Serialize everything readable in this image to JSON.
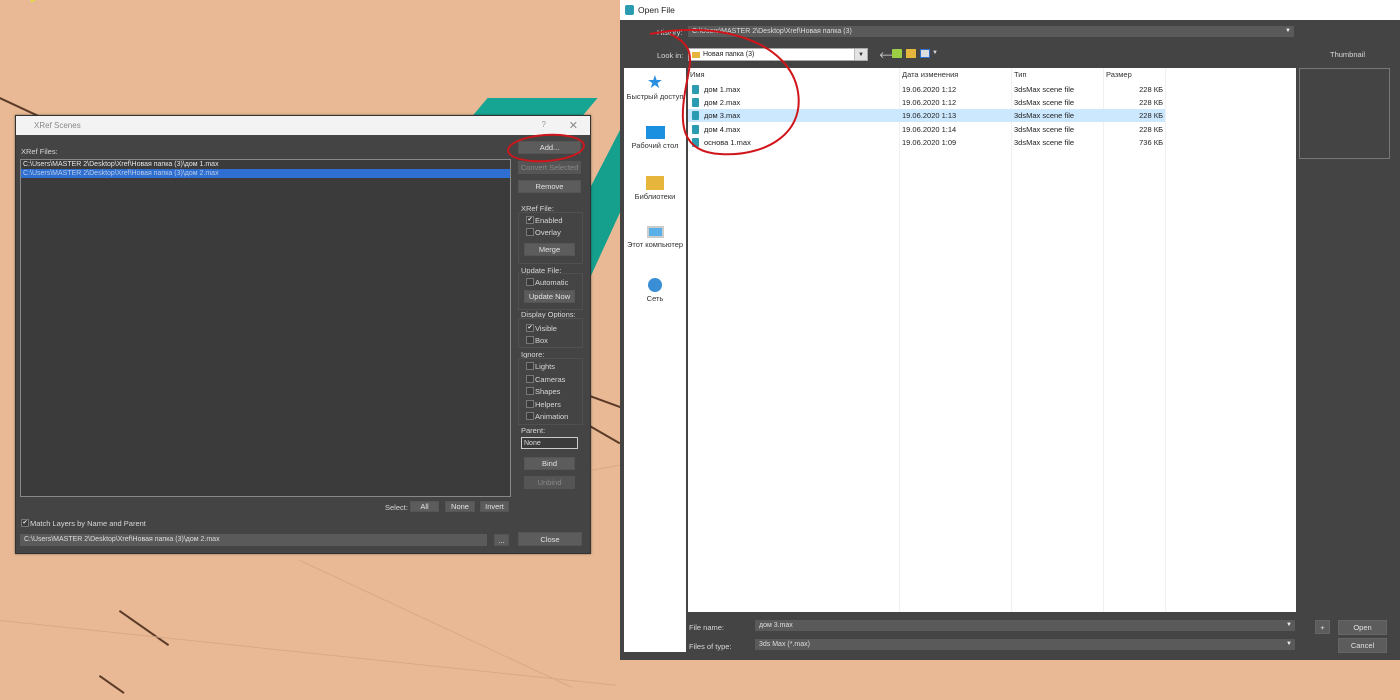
{
  "xref_dialog": {
    "title": "XRef Scenes",
    "help_glyph": "?",
    "close_glyph": "✕",
    "files_label": "XRef Files:",
    "files": [
      {
        "path": "C:\\Users\\MASTER 2\\Desktop\\Xref\\Новая папка (3)\\дом 1.max",
        "selected": false
      },
      {
        "path": "C:\\Users\\MASTER 2\\Desktop\\Xref\\Новая папка (3)\\дом 2.max",
        "selected": true
      }
    ],
    "add_label": "Add...",
    "convert_label": "Convert Selected",
    "remove_label": "Remove",
    "xref_file_label": "XRef File:",
    "enabled_label": "Enabled",
    "overlay_label": "Overlay",
    "merge_label": "Merge",
    "update_file_label": "Update File:",
    "automatic_label": "Automatic",
    "update_now_label": "Update Now",
    "display_options_label": "Display Options:",
    "visible_label": "Visible",
    "box_label": "Box",
    "ignore_label": "Ignore:",
    "lights_label": "Lights",
    "cameras_label": "Cameras",
    "shapes_label": "Shapes",
    "helpers_label": "Helpers",
    "animation_label": "Animation",
    "parent_label": "Parent:",
    "parent_value": "None",
    "bind_label": "Bind",
    "unbind_label": "Unbind",
    "select_label": "Select:",
    "all_label": "All",
    "none_label": "None",
    "invert_label": "Invert",
    "match_layers_label": "Match Layers by Name and Parent",
    "current_path": "C:\\Users\\MASTER 2\\Desktop\\Xref\\Новая папка (3)\\дом 2.max",
    "browse_label": "...",
    "close_label": "Close",
    "check_glyph": "✔"
  },
  "open_dialog": {
    "title": "Open File",
    "history_label": "History:",
    "history_value": "C:\\Users\\MASTER 2\\Desktop\\Xref\\Новая папка (3)",
    "look_in_label": "Look in:",
    "look_in_value": "Новая папка (3)",
    "thumbnail_label": "Thumbnail",
    "places": [
      {
        "label": "Быстрый доступ",
        "icon": "star-icon"
      },
      {
        "label": "Рабочий стол",
        "icon": "desktop-icon"
      },
      {
        "label": "Библиотеки",
        "icon": "libraries-icon"
      },
      {
        "label": "Этот компьютер",
        "icon": "computer-icon"
      },
      {
        "label": "Сеть",
        "icon": "network-icon"
      }
    ],
    "columns": {
      "name": "Имя",
      "date": "Дата изменения",
      "type": "Тип",
      "size": "Размер"
    },
    "files": [
      {
        "name": "дом 1.max",
        "date": "19.06.2020 1:12",
        "type": "3dsMax scene file",
        "size": "228 КБ",
        "selected": false
      },
      {
        "name": "дом 2.max",
        "date": "19.06.2020 1:12",
        "type": "3dsMax scene file",
        "size": "228 КБ",
        "selected": false
      },
      {
        "name": "дом 3.max",
        "date": "19.06.2020 1:13",
        "type": "3dsMax scene file",
        "size": "228 КБ",
        "selected": true
      },
      {
        "name": "дом 4.max",
        "date": "19.06.2020 1:14",
        "type": "3dsMax scene file",
        "size": "228 КБ",
        "selected": false
      },
      {
        "name": "основа 1.max",
        "date": "19.06.2020 1:09",
        "type": "3dsMax scene file",
        "size": "736 КБ",
        "selected": false
      }
    ],
    "file_name_label": "File name:",
    "file_name_value": "дом 3.max",
    "files_of_type_label": "Files of type:",
    "files_of_type_value": "3ds Max (*.max)",
    "plus_label": "+",
    "open_label": "Open",
    "cancel_label": "Cancel"
  },
  "colors": {
    "annotation": "#d0151b",
    "selection": "#2e6fd1",
    "viewport": "#e8b994"
  }
}
